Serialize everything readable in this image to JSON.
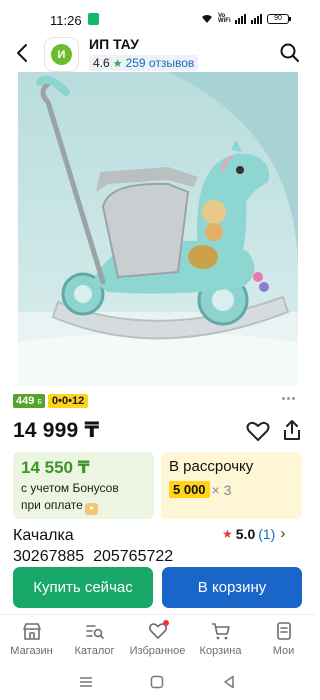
{
  "status_bar": {
    "time": "11:26",
    "battery": "90",
    "wifi_label": "Vo WiFi"
  },
  "header": {
    "seller_initial": "И",
    "seller_name": "ИП ТАУ",
    "rating": "4.6",
    "reviews": "259 отзывов"
  },
  "badges": {
    "bonus_amount": "449",
    "bonus_currency": "Б",
    "installment": "0•0•12"
  },
  "price": "14 999 ₸",
  "bonus_card": {
    "price": "14 550 ₸",
    "text_line1": "с учетом Бонусов",
    "text_line2": "при оплате"
  },
  "installment_card": {
    "title": "В рассрочку",
    "amount": "5 000",
    "multiplier": "× 3"
  },
  "product": {
    "title": "Качалка",
    "sku": "30267885_205765722",
    "rating": "5.0",
    "rating_count": "(1)"
  },
  "actions": {
    "buy_now": "Купить сейчас",
    "add_to_cart": "В корзину"
  },
  "bottom_nav": [
    {
      "label": "Магазин",
      "icon": "shop-icon"
    },
    {
      "label": "Каталог",
      "icon": "catalog-icon"
    },
    {
      "label": "Избранное",
      "icon": "heart-icon"
    },
    {
      "label": "Корзина",
      "icon": "cart-icon"
    },
    {
      "label": "Мои",
      "icon": "orders-icon"
    }
  ],
  "colors": {
    "buy_button": "#17a86a",
    "cart_button": "#1a65c8",
    "bonus_green": "#3f9426",
    "installment_yellow": "#ffd31a"
  }
}
